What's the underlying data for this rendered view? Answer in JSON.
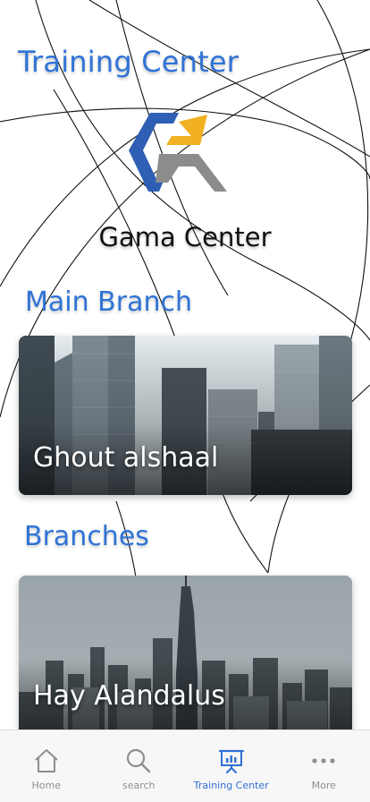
{
  "header": {
    "title": "Training Center"
  },
  "brand": {
    "name": "Gama Center",
    "logo_icon": "gama-logo-icon",
    "colors": {
      "blue": "#2f5fb4",
      "yellow": "#f2b123",
      "gray": "#8c8c8c"
    }
  },
  "sections": {
    "main": {
      "title": "Main Branch",
      "card_label": "Ghout alshaal"
    },
    "branches": {
      "title": "Branches",
      "card_label": "Hay Alandalus"
    }
  },
  "tabbar": {
    "items": [
      {
        "label": "Home",
        "icon": "home-icon"
      },
      {
        "label": "search",
        "icon": "search-icon"
      },
      {
        "label": "Training Center",
        "icon": "presentation-icon"
      },
      {
        "label": "More",
        "icon": "more-dots-icon"
      }
    ],
    "active_index": 2,
    "active_color": "#2f6fd6",
    "inactive_color": "#8e8e8e"
  },
  "theme": {
    "accent": "#2f73d6"
  }
}
